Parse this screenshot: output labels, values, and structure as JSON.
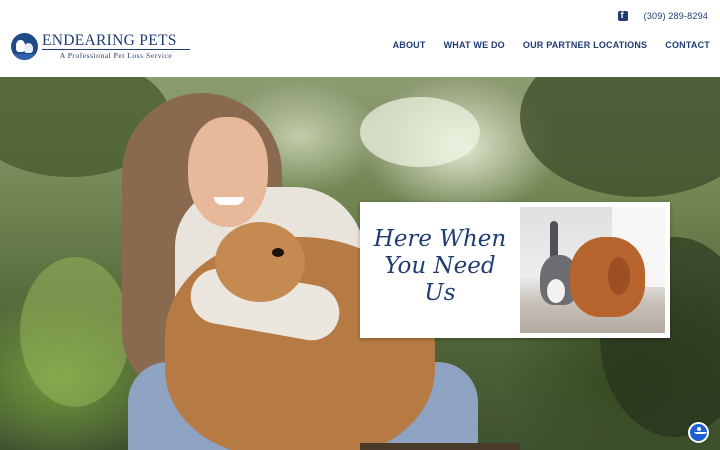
{
  "header": {
    "brand": {
      "title": "ENDEARING PETS",
      "subtitle": "A Professional Pet Loss Service",
      "logo_icon": "pets-silhouette-icon"
    },
    "contact": {
      "social_icon": "facebook-icon",
      "phone": "(309) 289-8294"
    },
    "nav": [
      {
        "label": "ABOUT"
      },
      {
        "label": "WHAT WE DO"
      },
      {
        "label": "OUR PARTNER LOCATIONS"
      },
      {
        "label": "CONTACT"
      }
    ]
  },
  "hero": {
    "tagline": "Here When You Need Us",
    "accent_color": "#1f3c73"
  },
  "accessibility": {
    "icon": "accessibility-icon",
    "color": "#1b5fd0"
  }
}
